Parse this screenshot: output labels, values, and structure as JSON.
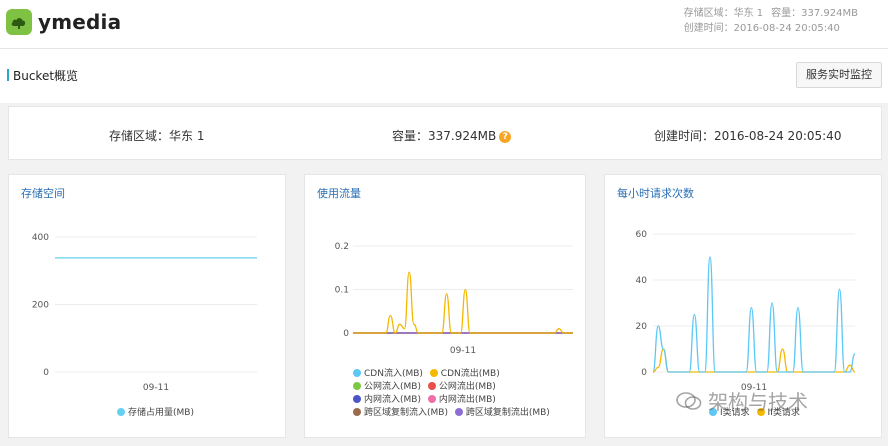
{
  "header": {
    "brand": "ymedia",
    "region_text": "存储区域：华东 1",
    "capacity_text": "容量：337.924MB",
    "created_text": "创建时间：2016-08-24 20:05:40"
  },
  "subbar": {
    "title": "Bucket概览",
    "monitor_button": "服务实时监控"
  },
  "summary": {
    "region": "存储区域：华东 1",
    "capacity": "容量：337.924MB",
    "capacity_help": "?",
    "created": "创建时间：2016-08-24 20:05:40"
  },
  "panels": {
    "storage_title": "存储空间",
    "traffic_title": "使用流量",
    "requests_title": "每小时请求次数"
  },
  "legends": {
    "storage": [
      "存储占用量(MB)"
    ],
    "traffic": [
      "CDN流入(MB)",
      "CDN流出(MB)",
      "公网流入(MB)",
      "公网流出(MB)",
      "内网流入(MB)",
      "内网流出(MB)",
      "跨区域复制流入(MB)",
      "跨区域复制流出(MB)"
    ],
    "requests": [
      "I类请求",
      "II类请求"
    ]
  },
  "chart_data": [
    {
      "type": "line",
      "title": "存储空间",
      "x_tick_labels": [
        "09-11"
      ],
      "y_ticks": [
        0,
        200,
        400
      ],
      "ylim": [
        0,
        400
      ],
      "series": [
        {
          "name": "存储占用量(MB)",
          "color": "#66d0f0",
          "values": [
            338,
            338
          ]
        }
      ],
      "grid": true,
      "legend": "bottom"
    },
    {
      "type": "line",
      "title": "使用流量",
      "x_tick_labels": [
        "09-11"
      ],
      "y_ticks": [
        0,
        0.1,
        0.2
      ],
      "ylim": [
        0,
        0.2
      ],
      "series": [
        {
          "name": "CDN流入(MB)",
          "color": "#5bc8f5",
          "values": [
            0,
            0,
            0,
            0,
            0,
            0,
            0,
            0,
            0,
            0,
            0,
            0,
            0,
            0,
            0,
            0,
            0,
            0,
            0,
            0,
            0,
            0,
            0,
            0,
            0,
            0,
            0,
            0,
            0,
            0,
            0,
            0,
            0,
            0,
            0,
            0,
            0,
            0,
            0,
            0,
            0,
            0,
            0,
            0,
            0,
            0,
            0,
            0
          ]
        },
        {
          "name": "CDN流出(MB)",
          "color": "#f5b800",
          "values": [
            0,
            0,
            0,
            0,
            0,
            0,
            0,
            0,
            0.04,
            0,
            0.02,
            0.01,
            0.14,
            0.02,
            0,
            0,
            0,
            0,
            0,
            0,
            0.09,
            0,
            0,
            0,
            0.1,
            0,
            0,
            0,
            0,
            0,
            0,
            0,
            0,
            0,
            0,
            0,
            0,
            0,
            0,
            0,
            0,
            0,
            0,
            0,
            0.01,
            0,
            0,
            0
          ]
        },
        {
          "name": "公网流入(MB)",
          "color": "#7ac943",
          "values": [
            0,
            0,
            0,
            0,
            0,
            0,
            0,
            0,
            0,
            0,
            0,
            0,
            0,
            0,
            0,
            0,
            0,
            0,
            0,
            0,
            0,
            0,
            0,
            0,
            0,
            0,
            0,
            0,
            0,
            0,
            0,
            0,
            0,
            0,
            0,
            0,
            0,
            0,
            0,
            0,
            0,
            0,
            0,
            0,
            0,
            0,
            0,
            0
          ]
        },
        {
          "name": "公网流出(MB)",
          "color": "#e8504a",
          "values": [
            0,
            0,
            0,
            0,
            0,
            0,
            0,
            0,
            0,
            0,
            0,
            0,
            0,
            0,
            0,
            0,
            0,
            0,
            0,
            0,
            0,
            0,
            0,
            0,
            0,
            0,
            0,
            0,
            0,
            0,
            0,
            0,
            0,
            0,
            0,
            0,
            0,
            0,
            0,
            0,
            0,
            0,
            0,
            0,
            0,
            0,
            0,
            0
          ]
        },
        {
          "name": "内网流入(MB)",
          "color": "#4a56c8",
          "values": [
            0,
            0,
            0,
            0,
            0,
            0,
            0,
            0,
            0,
            0,
            0,
            0,
            0,
            0,
            0,
            0,
            0,
            0,
            0,
            0,
            0,
            0,
            0,
            0,
            0,
            0,
            0,
            0,
            0,
            0,
            0,
            0,
            0,
            0,
            0,
            0,
            0,
            0,
            0,
            0,
            0,
            0,
            0,
            0,
            0,
            0,
            0,
            0
          ]
        },
        {
          "name": "内网流出(MB)",
          "color": "#f06fa7",
          "values": [
            0,
            0,
            0,
            0,
            0,
            0,
            0,
            0,
            0,
            0,
            0,
            0,
            0,
            0,
            0,
            0,
            0,
            0,
            0,
            0,
            0,
            0,
            0,
            0,
            0,
            0,
            0,
            0,
            0,
            0,
            0,
            0,
            0,
            0,
            0,
            0,
            0,
            0,
            0,
            0,
            0,
            0,
            0,
            0,
            0,
            0,
            0,
            0
          ]
        },
        {
          "name": "跨区域复制流入(MB)",
          "color": "#9a6b4b",
          "values": [
            0,
            0,
            0,
            0,
            0,
            0,
            0,
            0,
            0,
            0,
            0,
            0,
            0,
            0,
            0,
            0,
            0,
            0,
            0,
            0,
            0,
            0,
            0,
            0,
            0,
            0,
            0,
            0,
            0,
            0,
            0,
            0,
            0,
            0,
            0,
            0,
            0,
            0,
            0,
            0,
            0,
            0,
            0,
            0,
            0,
            0,
            0,
            0
          ]
        },
        {
          "name": "跨区域复制流出(MB)",
          "color": "#8c6fd1",
          "values": [
            0,
            0,
            0,
            0,
            0,
            0,
            0,
            0,
            0,
            0,
            0,
            0,
            0,
            0,
            0,
            0,
            0,
            0,
            0,
            0,
            0,
            0,
            0,
            0,
            0,
            0,
            0,
            0,
            0,
            0,
            0,
            0,
            0,
            0,
            0,
            0,
            0,
            0,
            0,
            0,
            0,
            0,
            0,
            0,
            0,
            0,
            0,
            0
          ]
        }
      ],
      "grid": true,
      "legend": "bottom"
    },
    {
      "type": "line",
      "title": "每小时请求次数",
      "x_tick_labels": [
        "09-11"
      ],
      "y_ticks": [
        0,
        20,
        40,
        60
      ],
      "ylim": [
        0,
        60
      ],
      "series": [
        {
          "name": "I类请求",
          "color": "#5bc8f5",
          "values": [
            0,
            20,
            10,
            0,
            0,
            0,
            0,
            0,
            25,
            0,
            0,
            50,
            0,
            0,
            0,
            0,
            0,
            0,
            0,
            28,
            0,
            0,
            0,
            30,
            0,
            0,
            0,
            0,
            28,
            0,
            0,
            0,
            0,
            0,
            0,
            0,
            36,
            0,
            0,
            8
          ]
        },
        {
          "name": "II类请求",
          "color": "#f5b800",
          "values": [
            0,
            2,
            10,
            0,
            0,
            0,
            0,
            0,
            0,
            0,
            0,
            0,
            0,
            0,
            0,
            0,
            0,
            0,
            0,
            0,
            0,
            0,
            0,
            0,
            0,
            10,
            0,
            0,
            0,
            0,
            0,
            0,
            0,
            0,
            0,
            0,
            0,
            0,
            3,
            0
          ]
        }
      ],
      "grid": true,
      "legend": "bottom"
    }
  ],
  "watermark": "架构与技术"
}
